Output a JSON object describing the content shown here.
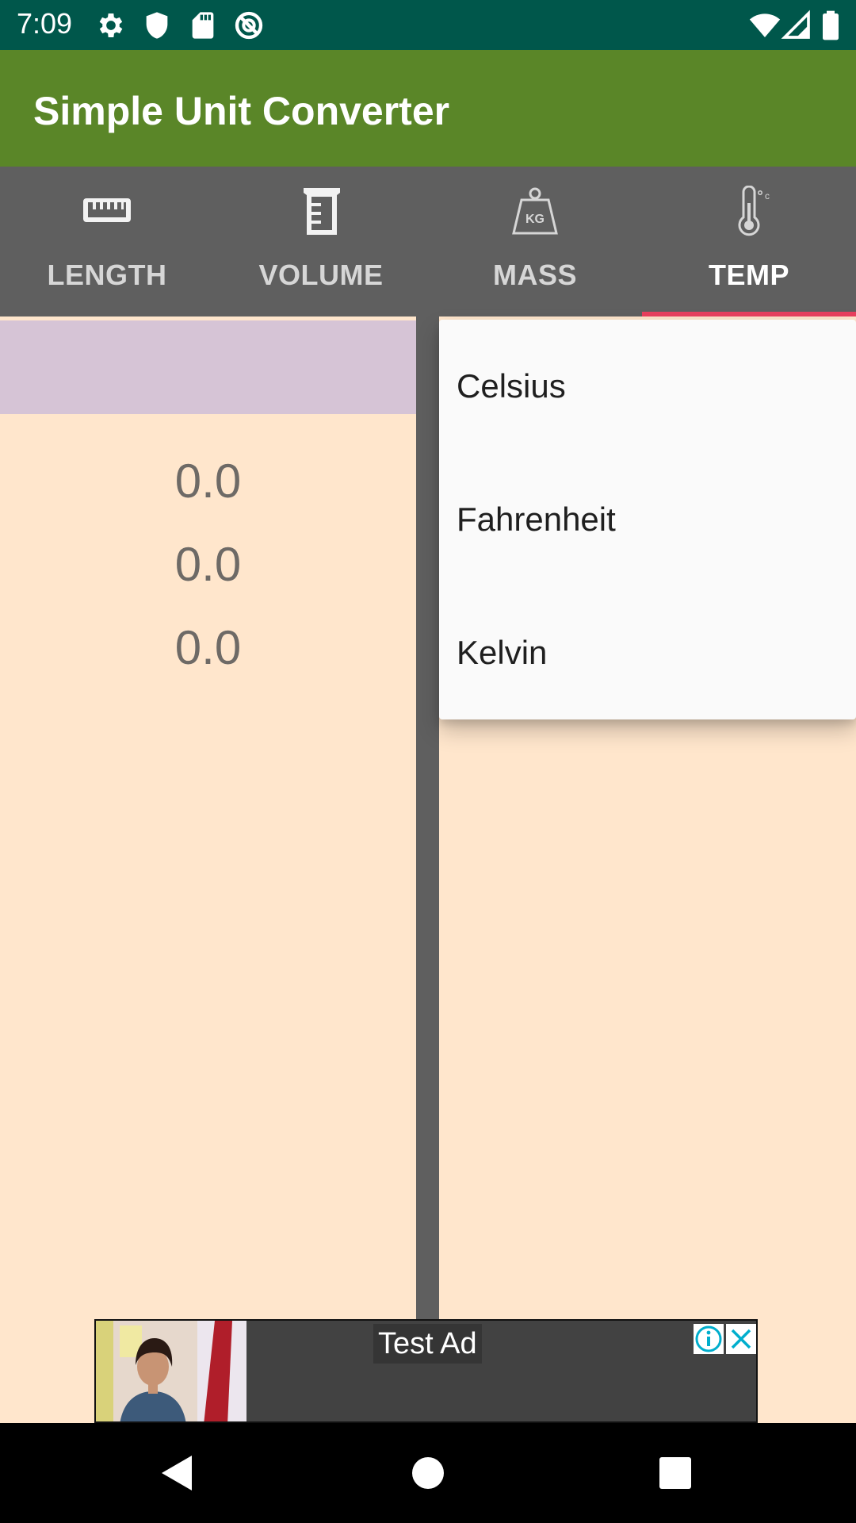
{
  "status_bar": {
    "time": "7:09",
    "left_icons": [
      "gear-icon",
      "shield-icon",
      "sd-card-icon",
      "no-sync-icon"
    ],
    "right_icons": [
      "wifi-icon",
      "signal-icon",
      "battery-icon"
    ]
  },
  "app_bar": {
    "title": "Simple Unit Converter",
    "color": "#5a8628"
  },
  "tabs": [
    {
      "label": "LENGTH",
      "icon": "ruler-icon",
      "active": false
    },
    {
      "label": "VOLUME",
      "icon": "beaker-icon",
      "active": false
    },
    {
      "label": "MASS",
      "icon": "kg-weight-icon",
      "active": false
    },
    {
      "label": "TEMP",
      "icon": "thermometer-icon",
      "active": true
    }
  ],
  "left_pane": {
    "values": [
      "0.0",
      "0.0",
      "0.0"
    ]
  },
  "dropdown": {
    "options": [
      "Celsius",
      "Fahrenheit",
      "Kelvin"
    ]
  },
  "ad": {
    "label": "Test Ad"
  },
  "colors": {
    "status_bar": "#00574b",
    "tab_bar": "#5f5f5f",
    "tab_indicator": "#e8405e",
    "pane_bg": "#ffe6cc",
    "header_bg": "#d6c4d6"
  }
}
